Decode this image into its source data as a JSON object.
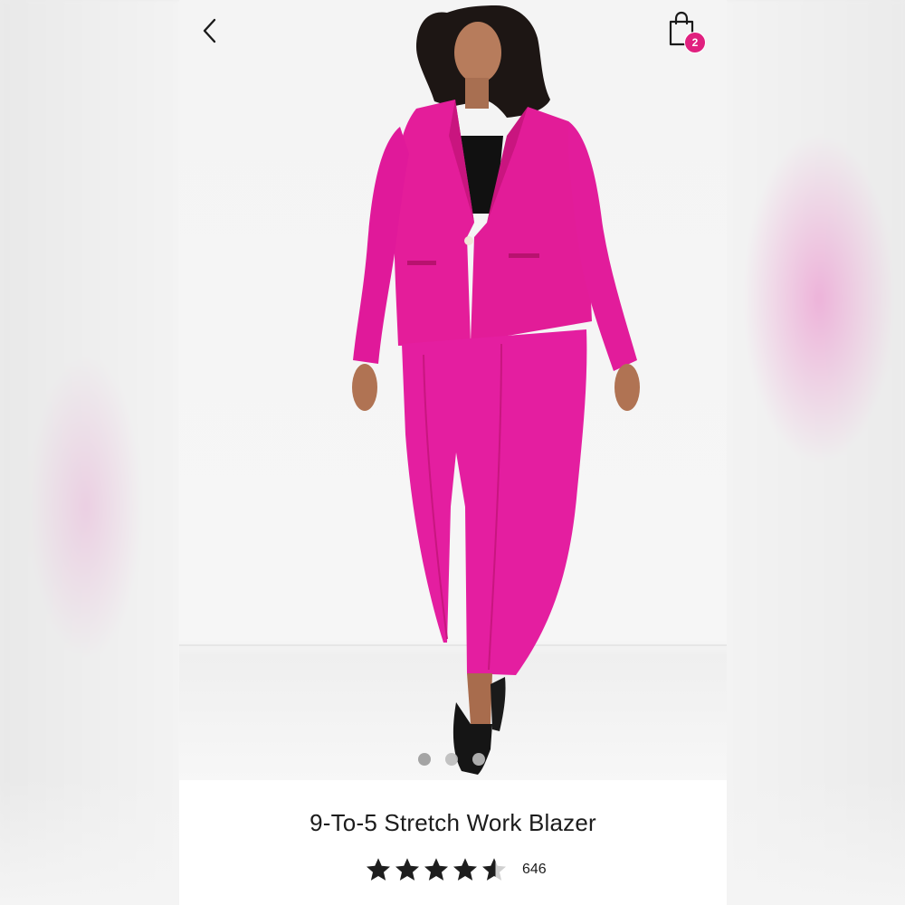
{
  "header": {
    "back_icon": "chevron-left-icon",
    "bag_icon": "shopping-bag-icon",
    "bag_count": "2",
    "badge_color": "#e0207f"
  },
  "gallery": {
    "image_subject": "model-in-pink-suit",
    "total_pages": 3,
    "active_page": 1,
    "suit_color": "#e8209a"
  },
  "product": {
    "title": "9-To-5 Stretch Work Blazer",
    "rating_value": 4.5,
    "rating_max": 5,
    "review_count": "646",
    "star_icon": "star-icon"
  }
}
